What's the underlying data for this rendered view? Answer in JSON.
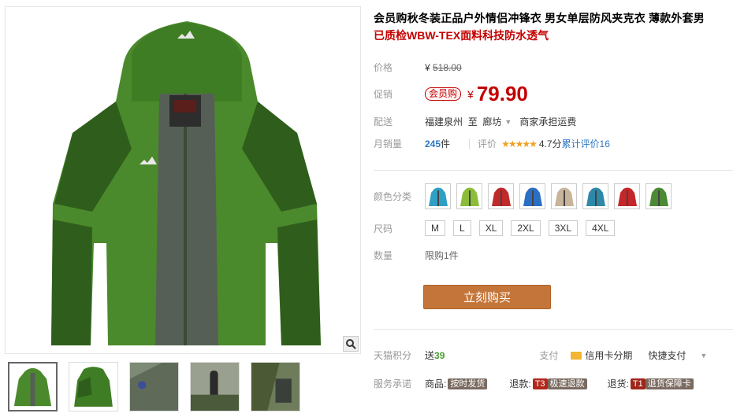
{
  "product": {
    "title": "会员购秋冬装正品户外情侣冲锋衣 男女单层防风夹克衣 薄款外套男",
    "subtitle": "已质检WBW-TEX面料科技防水透气"
  },
  "pricing": {
    "price_label": "价格",
    "currency": "¥",
    "original_price": "518.00",
    "promo_label": "促销",
    "promo_tag": "会员购",
    "promo_price": "79.90"
  },
  "shipping": {
    "label": "配送",
    "from": "福建泉州",
    "to_word": "至",
    "destination": "廊坊",
    "fee_note": "商家承担运费"
  },
  "sales": {
    "label": "月销量",
    "count": "245",
    "unit": "件",
    "rating_label": "评价",
    "stars": "★★★★★",
    "score": "4.7分",
    "review_text": "累计评价16"
  },
  "options": {
    "color_label": "颜色分类",
    "colors": [
      "#2f9fc4",
      "#8cbd3a",
      "#c02a2a",
      "#2a6fc4",
      "#c9b49a",
      "#2f88a8",
      "#c4262a",
      "#4c8a34"
    ],
    "size_label": "尺码",
    "sizes": [
      "M",
      "L",
      "XL",
      "2XL",
      "3XL",
      "4XL"
    ],
    "qty_label": "数量",
    "qty_limit": "限购1件"
  },
  "buy_button": "立刻购买",
  "extras": {
    "points_label": "天猫积分",
    "points_prefix": "送",
    "points": "39",
    "pay_label": "支付",
    "credit_card": "信用卡分期",
    "quick_pay": "快捷支付",
    "service_label": "服务承诺",
    "goods_label": "商品:",
    "goods_badge": "按时发货",
    "refund_label": "退款:",
    "refund_code": "T3",
    "refund_badge": "极速退款",
    "return_label": "退货:",
    "return_code": "T1",
    "return_badge": "退货保障卡"
  },
  "colors_theme": {
    "accent_red": "#c40000",
    "buy_orange": "#c4763a",
    "link_blue": "#2c77c4"
  },
  "icons": [
    "zoom-icon",
    "card-icon",
    "chevron-down-icon"
  ]
}
